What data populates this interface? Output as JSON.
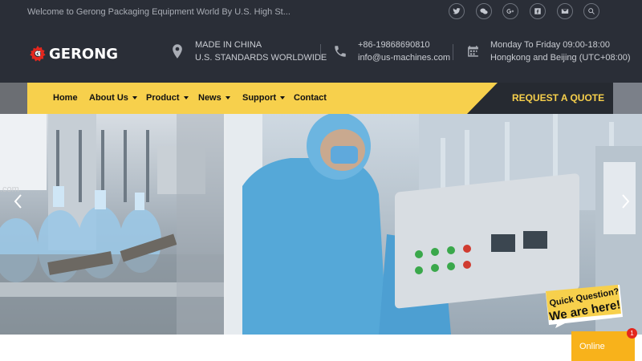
{
  "topbar": {
    "welcome_text": "Welcome to Gerong Packaging Equipment World By U.S. High St...",
    "social": [
      "twitter-icon",
      "wechat-icon",
      "google-plus-icon",
      "facebook-icon",
      "email-icon",
      "search-icon"
    ]
  },
  "brand": {
    "logo_text": "GERONG",
    "accent_color": "#f7d04c",
    "logo_color": "#e4271e"
  },
  "info": {
    "location": {
      "icon": "location-pin-icon",
      "line1": "MADE IN CHINA",
      "line2": "U.S. STANDARDS WORLDWIDE"
    },
    "contact": {
      "icon": "phone-icon",
      "line1": "+86-19868690810",
      "line2": "info@us-machines.com"
    },
    "hours": {
      "icon": "calendar-icon",
      "line1": "Monday To Friday 09:00-18:00",
      "line2": "Hongkong and Beijing (UTC+08:00)"
    }
  },
  "nav": {
    "items": [
      {
        "label": "Home"
      },
      {
        "label": "About Us"
      },
      {
        "label": "Product"
      },
      {
        "label": "News"
      },
      {
        "label": "Support"
      },
      {
        "label": "Contact"
      }
    ],
    "quote_label": "REQUEST A QUOTE"
  },
  "hero": {
    "watermark_text": ".com"
  },
  "chat": {
    "badge_line1": "Quick Question?",
    "badge_line2": "We are here!",
    "online_label": "Online",
    "unread_count": "1"
  }
}
